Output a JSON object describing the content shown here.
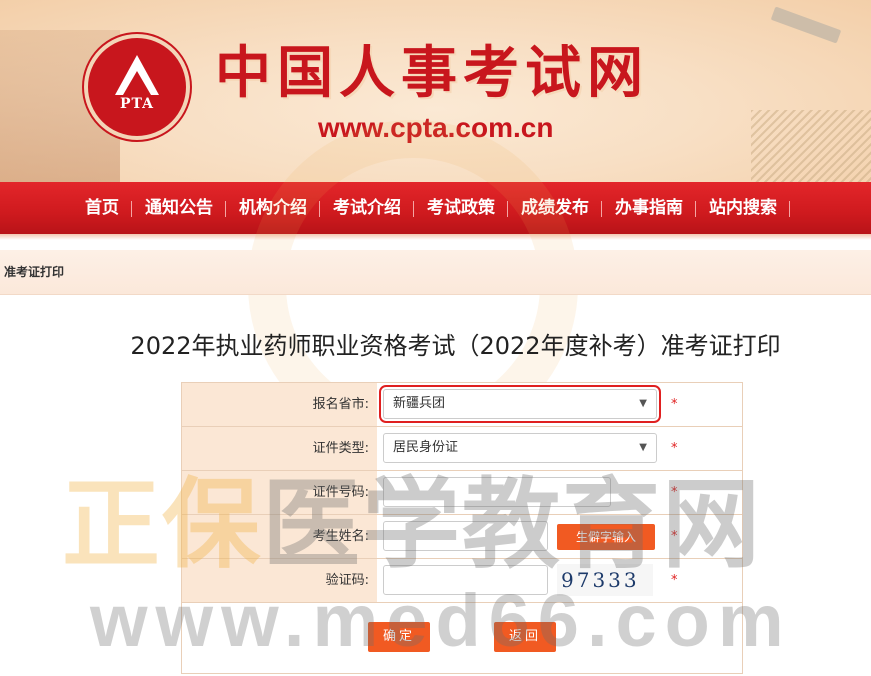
{
  "header": {
    "logo_text": "PTA",
    "site_title": "中国人事考试网",
    "site_url": "www.cpta.com.cn"
  },
  "nav": {
    "items": [
      "首页",
      "通知公告",
      "机构介绍",
      "考试介绍",
      "考试政策",
      "成绩发布",
      "办事指南",
      "站内搜索"
    ]
  },
  "breadcrumb": "准考证打印",
  "page_title": "2022年执业药师职业资格考试（2022年度补考）准考证打印",
  "form": {
    "province_label": "报名省市:",
    "province_value": "新疆兵团",
    "id_type_label": "证件类型:",
    "id_type_value": "居民身份证",
    "id_number_label": "证件号码:",
    "name_label": "考生姓名:",
    "rare_char_button": "生僻字输入",
    "captcha_label": "验证码:",
    "captcha_text": "97333",
    "required_mark": "*",
    "confirm_button": "确定",
    "back_button": "返回"
  },
  "watermark": {
    "cn_part1": "正保",
    "cn_part2": "医学教育网",
    "url": "www.med66.com"
  },
  "colors": {
    "brand_red": "#c8161d",
    "nav_red": "#cf1a1e",
    "button_orange": "#f15a22",
    "label_bg": "#fbe7d5"
  }
}
